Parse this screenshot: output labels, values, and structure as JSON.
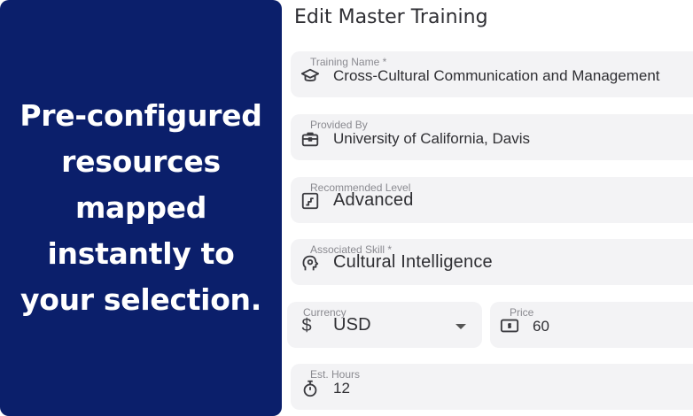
{
  "promo": {
    "lines": [
      "Pre-configured",
      "resources",
      "mapped",
      "instantly to",
      "your selection."
    ]
  },
  "form": {
    "title": "Edit Master Training",
    "fields": {
      "training_name": {
        "label": "Training Name *",
        "value": "Cross-Cultural Communication and Management",
        "icon": "graduation-cap-icon"
      },
      "provided_by": {
        "label": "Provided By",
        "value": "University of California, Davis",
        "icon": "briefcase-icon"
      },
      "recommended_level": {
        "label": "Recommended Level",
        "value": "Advanced",
        "icon": "stairs-icon"
      },
      "associated_skill": {
        "label": "Associated Skill *",
        "value": "Cultural Intelligence",
        "icon": "brain-head-icon"
      },
      "currency": {
        "label": "Currency",
        "value": "USD",
        "icon": "dollar-icon"
      },
      "price": {
        "label": "Price",
        "value": "60",
        "icon": "cash-icon"
      },
      "est_hours": {
        "label": "Est. Hours",
        "value": "12",
        "icon": "stopwatch-icon"
      }
    }
  },
  "colors": {
    "promo_background": "#0b1f6b",
    "field_background": "#f3f3f5",
    "label_gray": "#8a8a90"
  }
}
